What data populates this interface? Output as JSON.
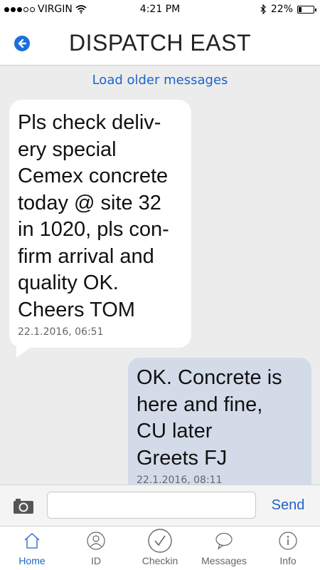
{
  "status_bar": {
    "carrier": "VIRGIN",
    "time": "4:21 PM",
    "battery": "22%",
    "battery_level": 0.22,
    "signal_bars_filled": 3,
    "signal_bars_total": 5
  },
  "header": {
    "title": "DISPATCH EAST",
    "back_icon": "back-arrow-icon"
  },
  "chat": {
    "load_older": "Load older messages",
    "messages": [
      {
        "direction": "incoming",
        "text": "Pls check deliv-\nery special\nCemex concrete\ntoday @ site 32\nin 1020, pls con-\nfirm arrival and\nquality OK.\nCheers TOM",
        "time": "22.1.2016, 06:51"
      },
      {
        "direction": "outgoing",
        "text": "OK. Concrete is\nhere and fine,\nCU later\nGreets FJ",
        "time": "22.1.2016, 08:11"
      }
    ]
  },
  "composer": {
    "input_value": "",
    "input_placeholder": "",
    "send_label": "Send",
    "camera_icon": "camera-icon"
  },
  "tabs": [
    {
      "label": "Home",
      "icon": "home-icon",
      "active": true
    },
    {
      "label": "ID",
      "icon": "person-icon",
      "active": false
    },
    {
      "label": "Checkin",
      "icon": "checkmark-icon",
      "active": false
    },
    {
      "label": "Messages",
      "icon": "speech-bubble-icon",
      "active": false
    },
    {
      "label": "Info",
      "icon": "info-icon",
      "active": false
    }
  ],
  "colors": {
    "accent": "#1e64c8",
    "incoming_bubble": "#ffffff",
    "outgoing_bubble": "#d3dbe9",
    "chat_background": "#ececec"
  }
}
